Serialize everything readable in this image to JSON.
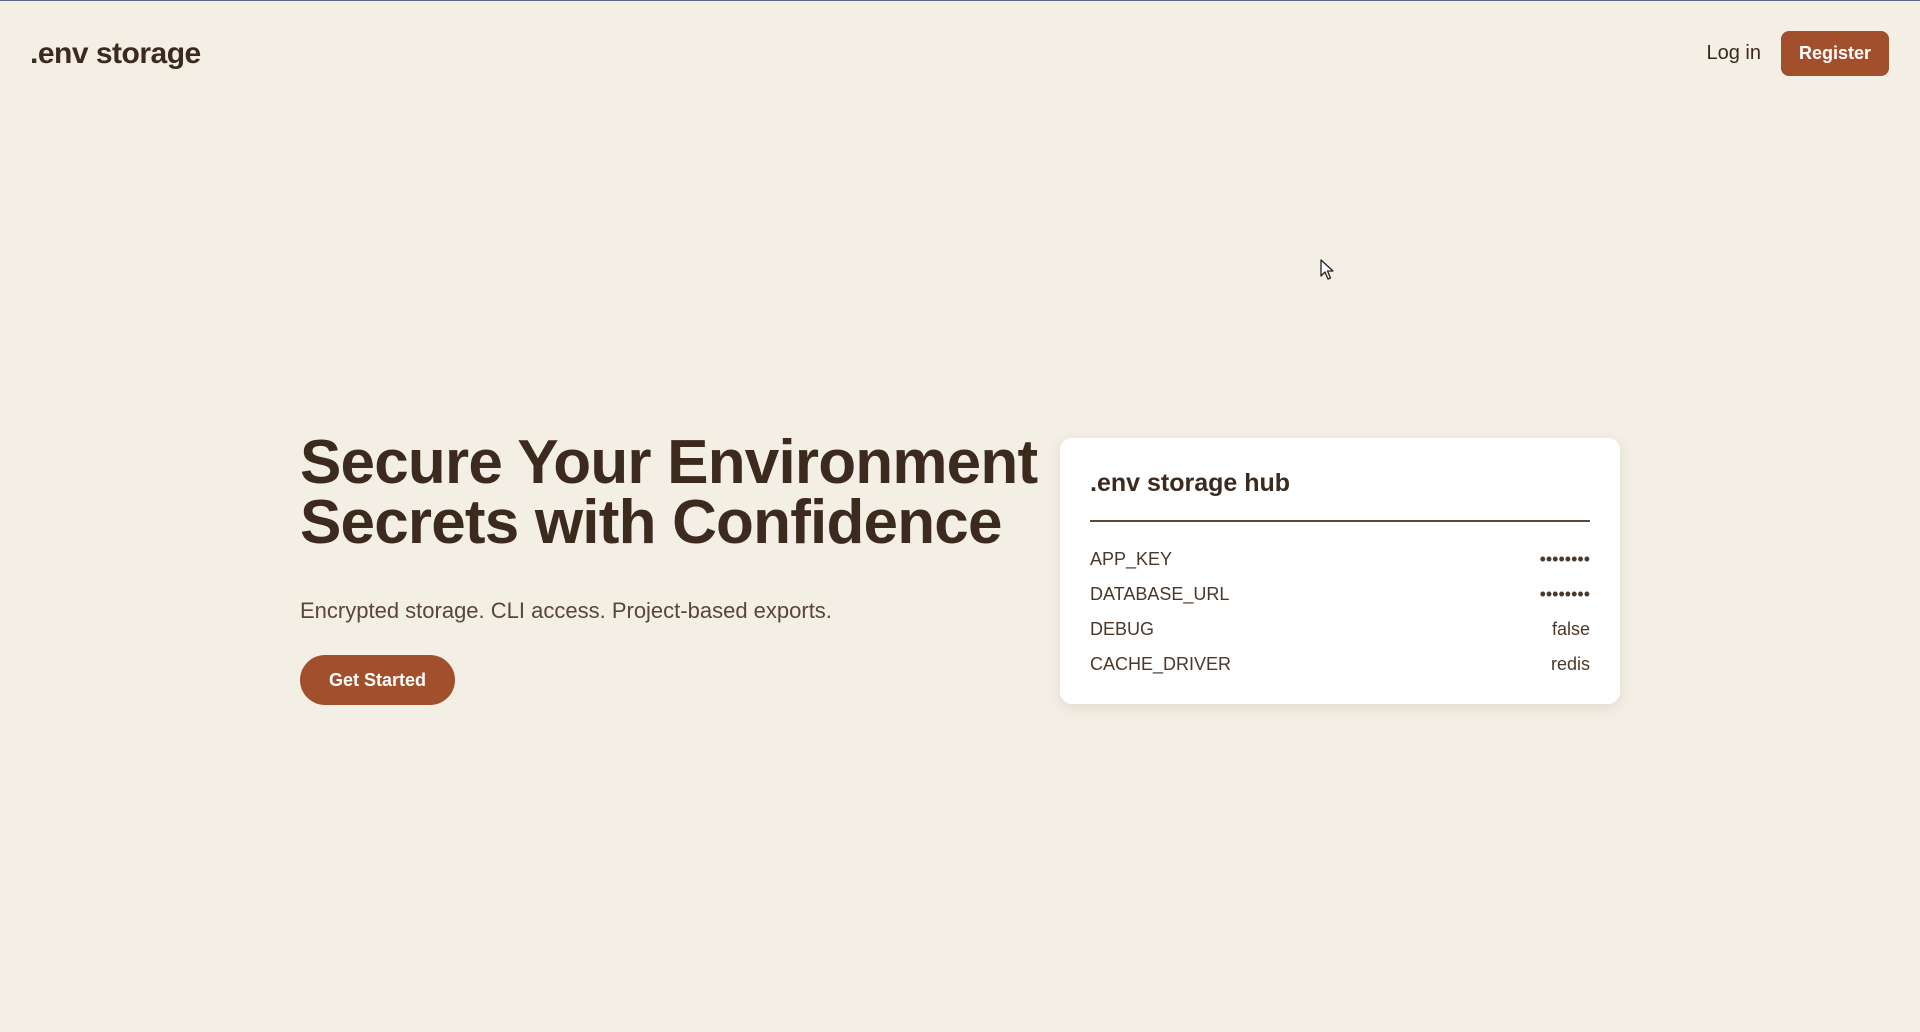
{
  "nav": {
    "brand": ".env storage",
    "login_label": "Log in",
    "register_label": "Register"
  },
  "hero": {
    "headline": "Secure Your Environment Secrets with Confidence",
    "subhead": "Encrypted storage. CLI access. Project-based exports.",
    "cta_label": "Get Started"
  },
  "card": {
    "title": ".env storage hub",
    "rows": [
      {
        "key": "APP_KEY",
        "value": "••••••••"
      },
      {
        "key": "DATABASE_URL",
        "value": "••••••••"
      },
      {
        "key": "DEBUG",
        "value": "false"
      },
      {
        "key": "CACHE_DRIVER",
        "value": "redis"
      }
    ]
  },
  "colors": {
    "background": "#f4efe5",
    "accent": "#a24f2c",
    "text": "#3b2a1d"
  }
}
